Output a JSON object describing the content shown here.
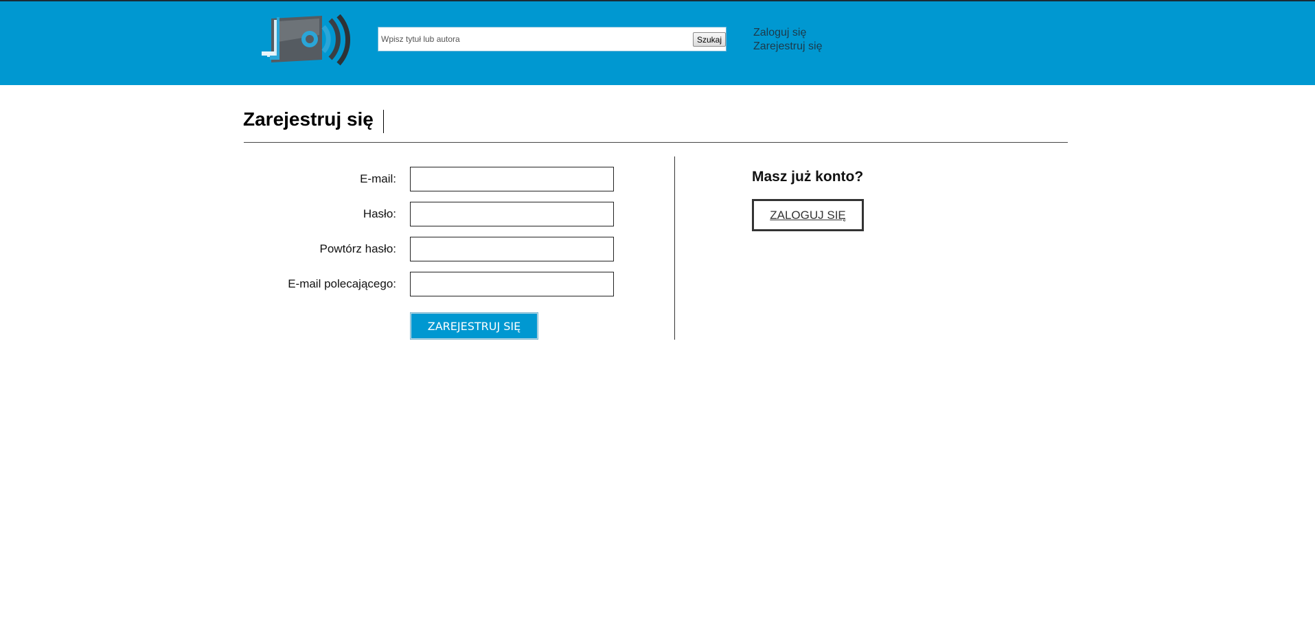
{
  "header": {
    "search_placeholder": "Wpisz tytuł lub autora",
    "search_button_label": "Szukaj",
    "login_link": "Zaloguj się",
    "register_link": "Zarejestruj się",
    "background_color": "#0098d1"
  },
  "page": {
    "title": "Zarejestruj się"
  },
  "register_form": {
    "fields": [
      {
        "label": "E-mail:",
        "value": ""
      },
      {
        "label": "Hasło:",
        "value": ""
      },
      {
        "label": "Powtórz hasło:",
        "value": ""
      },
      {
        "label": "E-mail polecającego:",
        "value": ""
      }
    ],
    "submit_label": "ZAREJESTRUJ SIĘ"
  },
  "login_panel": {
    "heading": "Masz już konto?",
    "button_label": "ZALOGUJ SIĘ"
  },
  "colors": {
    "accent": "#0098d1",
    "text": "#000000",
    "border": "#222222"
  }
}
